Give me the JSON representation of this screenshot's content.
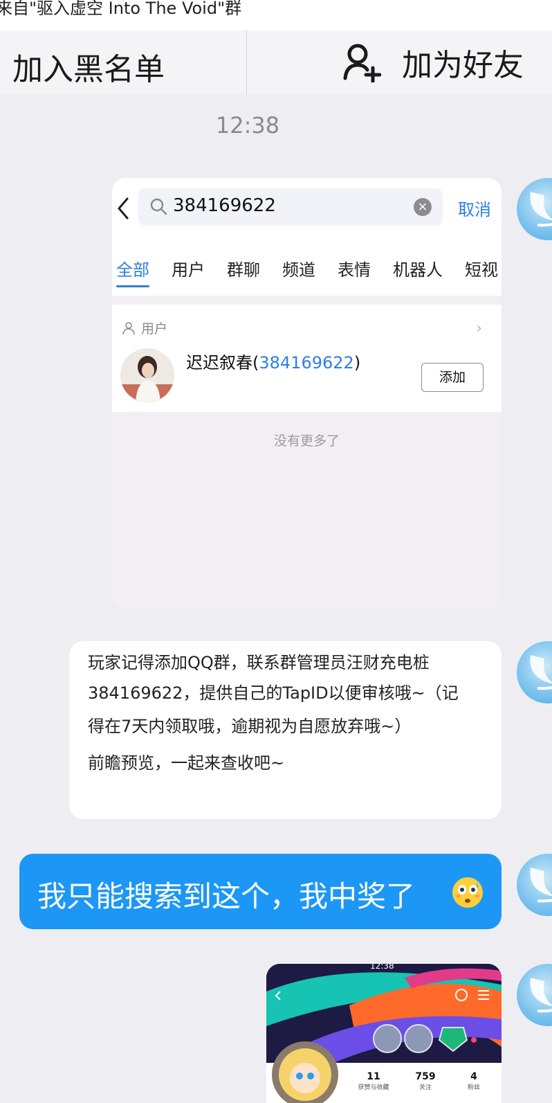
{
  "top_banner": {
    "text": "来自\"驱入虚空 Into The Void\"群"
  },
  "action_bar": {
    "blacklist_label": "加入黑名单",
    "add_friend_label": "加为好友"
  },
  "timestamp": "12:38",
  "screenshot_search": {
    "query": "384169622",
    "cancel_label": "取消",
    "tabs": [
      "全部",
      "用户",
      "群聊",
      "频道",
      "表情",
      "机器人",
      "短视"
    ],
    "active_tab": "全部",
    "section_label": "用户",
    "result": {
      "name": "迟迟叙春",
      "open_paren": "(",
      "id": "384169622",
      "close_paren": ")",
      "add_label": "添加"
    },
    "footer": "没有更多了"
  },
  "text_message": {
    "lines": [
      "玩家记得添加QQ群，联系群管理员汪财充电桩",
      "384169622，提供自己的TapID以便审核哦~（记",
      "得在7天内领取哦，逾期视为自愿放弃哦~）",
      "前瞻预览，一起来查收吧~"
    ]
  },
  "blue_message": {
    "text": "我只能搜索到这个，我中奖了",
    "emoji": "flushed-face-emoji"
  },
  "screenshot_profile": {
    "status_time": "12:38",
    "stats": [
      {
        "value": "11",
        "label": "获赞与收藏"
      },
      {
        "value": "759",
        "label": "关注"
      },
      {
        "value": "4",
        "label": "粉丝"
      }
    ]
  },
  "colors": {
    "accent_blue": "#1c97f5",
    "link_blue": "#2d7fe0",
    "background": "#eeeef2"
  }
}
